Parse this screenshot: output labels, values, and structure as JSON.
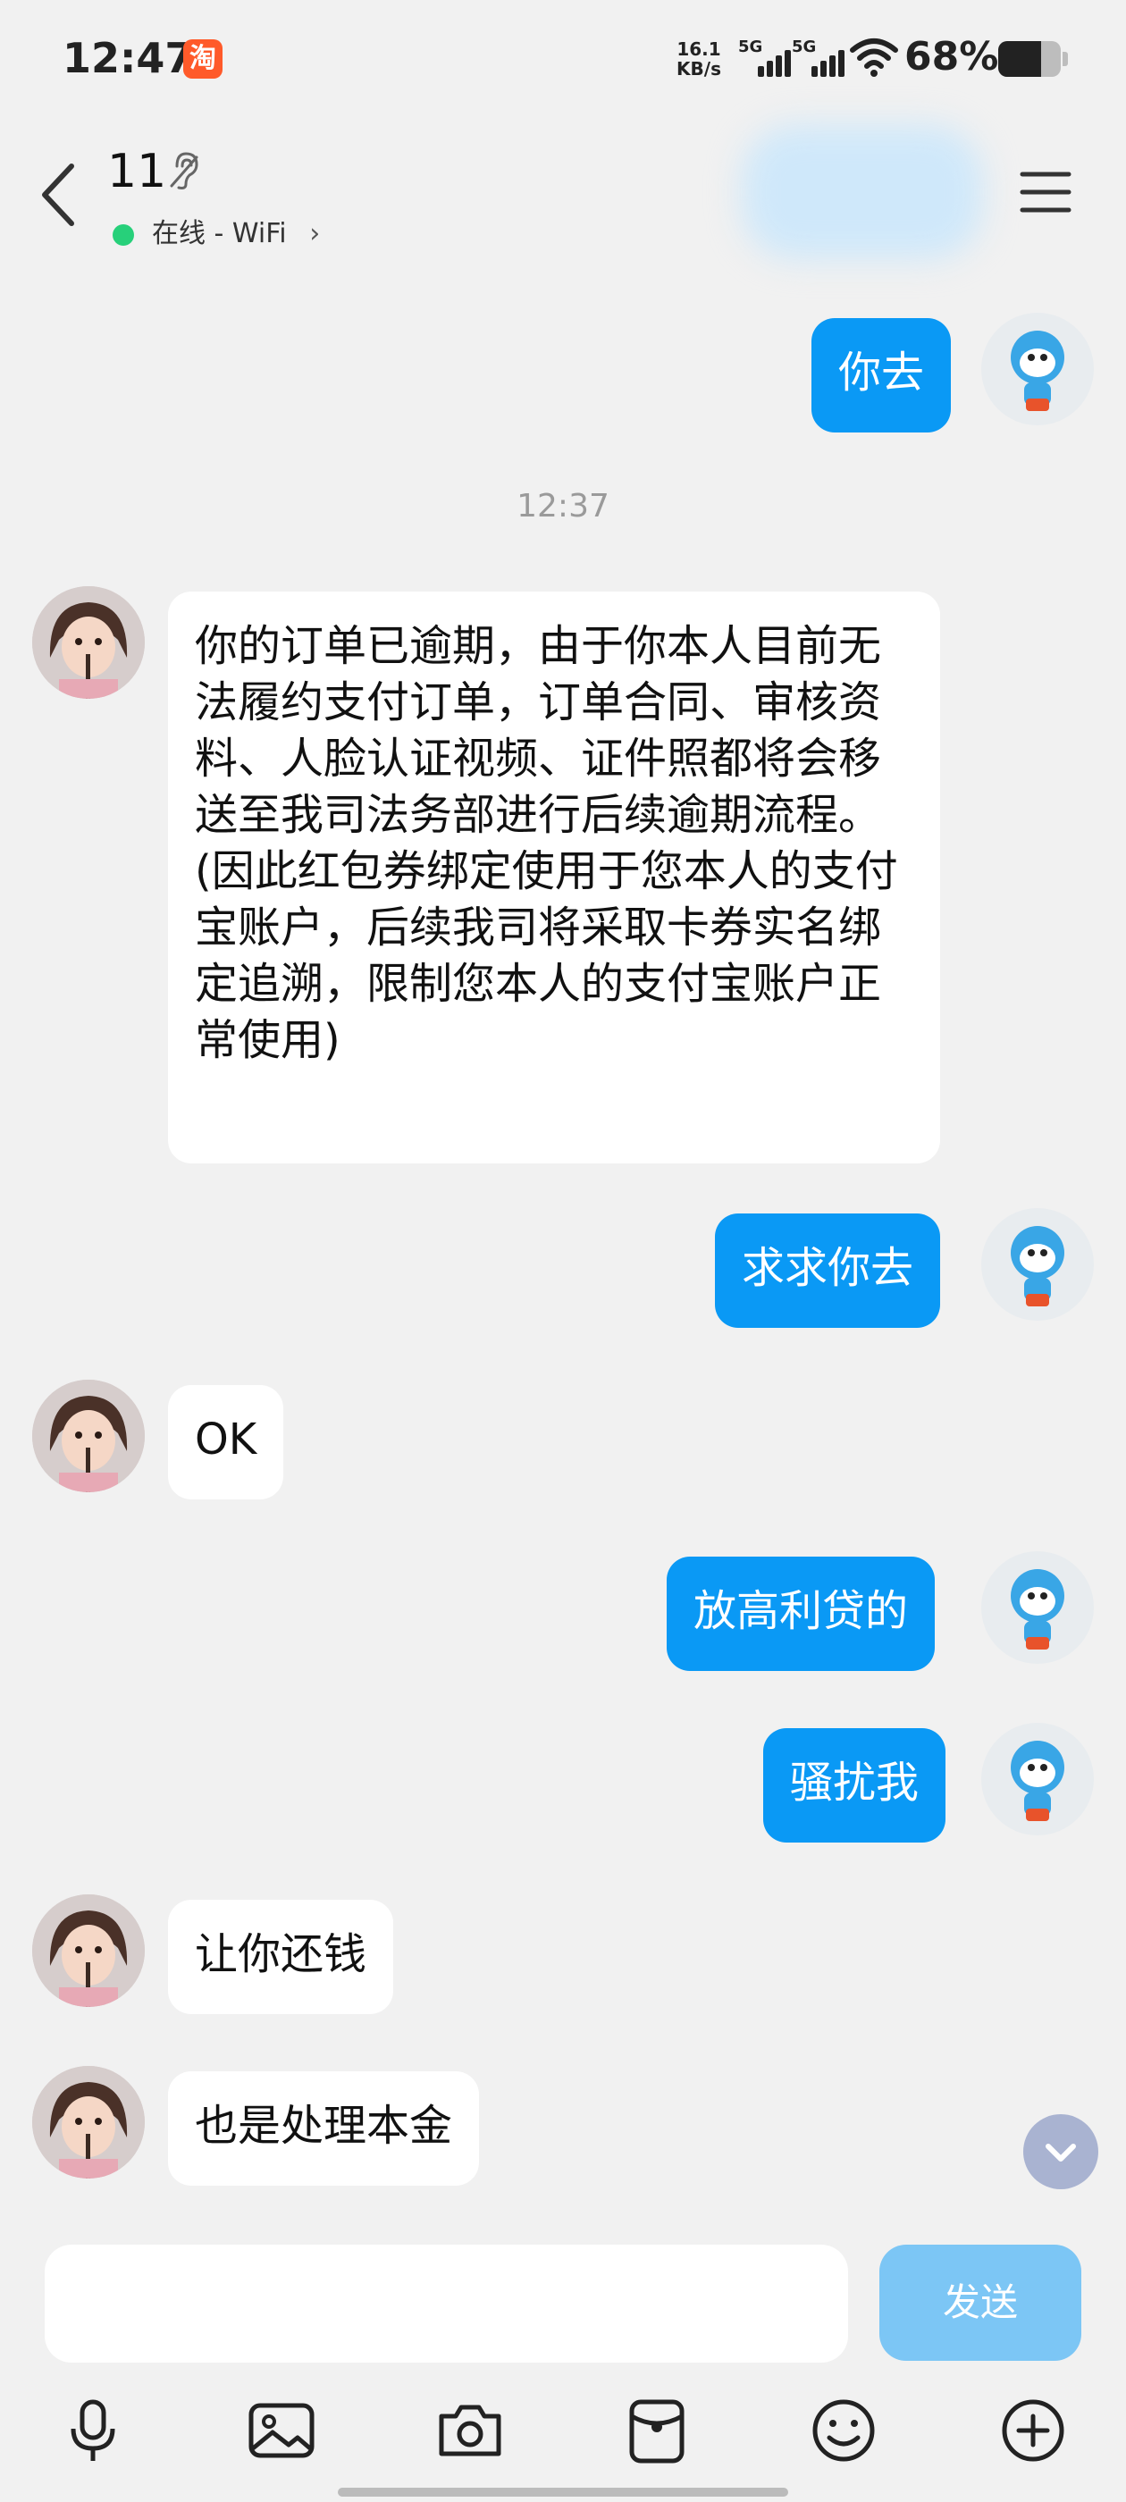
{
  "status_bar": {
    "time": "12:47",
    "app_icon_char": "淘",
    "net_speed_value": "16.1",
    "net_speed_unit": "KB/s",
    "signal1_label": "5G",
    "signal2_label": "5G",
    "battery_text": "68%",
    "battery_level": 0.68
  },
  "header": {
    "title": "11",
    "status": "在线 - WiFi",
    "status_chevron": "›"
  },
  "messages": [
    {
      "side": "out",
      "text": "你去"
    },
    {
      "type": "time",
      "text": "12:37"
    },
    {
      "side": "in",
      "text": "你的订单已逾期，由于你本人目前无法履约支付订单，订单合同、审核资料、人脸认证视频、证件照都将会移送至我司法务部进行后续逾期流程。(因此红包券绑定使用于您本人的支付宝账户，后续我司将采取卡券实名绑定追溯，限制您本人的支付宝账户正常使用)"
    },
    {
      "side": "out",
      "text": "求求你去"
    },
    {
      "side": "in",
      "text": "OK"
    },
    {
      "side": "out",
      "text": "放高利贷的"
    },
    {
      "side": "out",
      "text": "骚扰我"
    },
    {
      "side": "in",
      "text": "让你还钱"
    },
    {
      "side": "in",
      "text": "也是处理本金"
    }
  ],
  "input": {
    "send_label": "发送"
  },
  "toolbar": [
    "mic-icon",
    "image-icon",
    "camera-icon",
    "red-packet-icon",
    "emoji-icon",
    "plus-icon"
  ]
}
